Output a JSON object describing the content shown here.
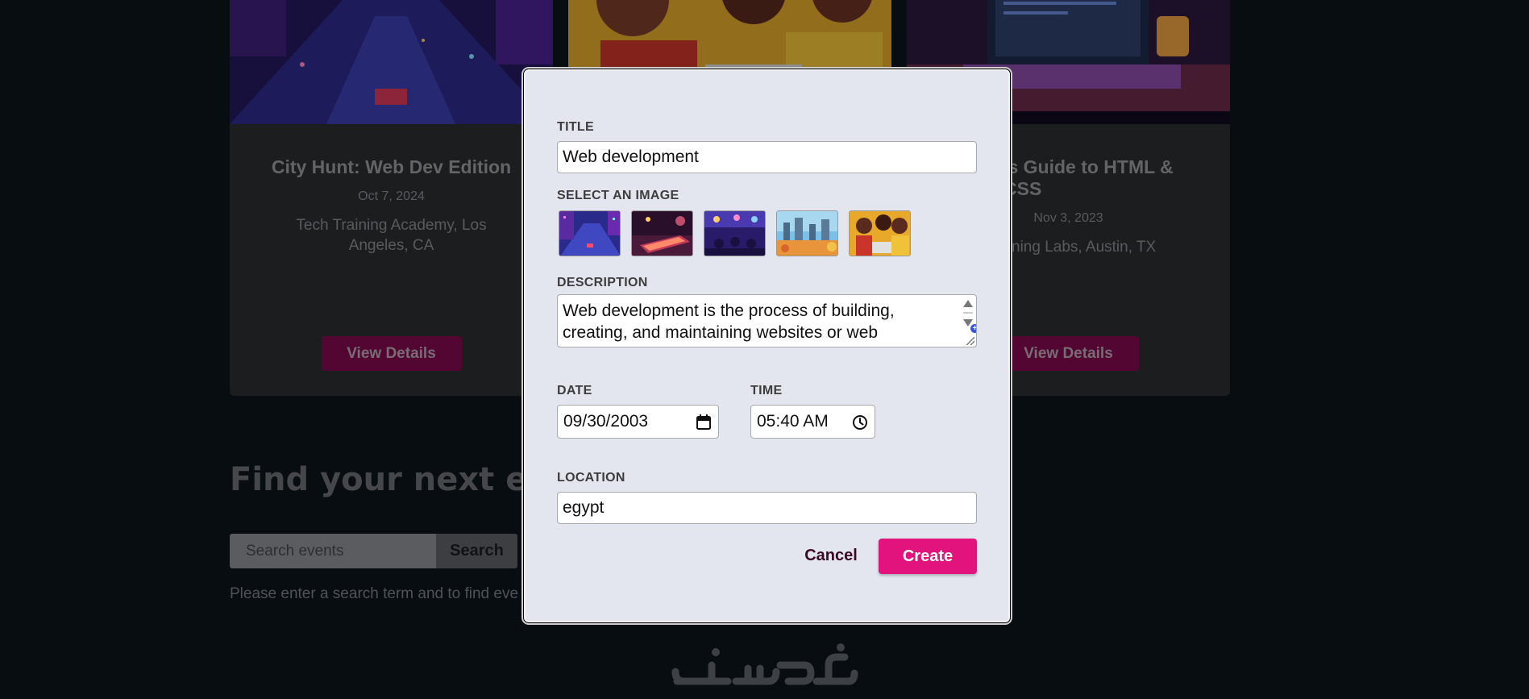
{
  "background": {
    "cards": [
      {
        "title": "City Hunt: Web Dev Edition",
        "date": "Oct 7, 2024",
        "location": "Tech Training Academy, Los Angeles, CA",
        "button": "View Details"
      },
      {
        "title": "",
        "date": "",
        "location": "",
        "button": ""
      },
      {
        "title": "'s Guide to HTML & CSS",
        "date": "Nov 3, 2023",
        "location": "ning Labs, Austin, TX",
        "button": "View Details"
      }
    ],
    "find_title": "Find your next eve",
    "search": {
      "placeholder": "Search events",
      "button": "Search"
    },
    "search_help": "Please enter a search term and to find eve",
    "brand": "logo"
  },
  "modal": {
    "title_label": "TITLE",
    "title_value": "Web development",
    "image_label": "SELECT AN IMAGE",
    "images": [
      "city-night-image",
      "keyboard-stage-image",
      "concert-crowd-image",
      "city-sunset-image",
      "friends-laptop-image"
    ],
    "description_label": "DESCRIPTION",
    "description_value": "Web development is the process of building, creating, and maintaining websites or web",
    "date_label": "DATE",
    "date_value": "09/30/2003",
    "time_label": "TIME",
    "time_value": "05:40 AM",
    "location_label": "LOCATION",
    "location_value": "egypt",
    "cancel_button": "Cancel",
    "create_button": "Create"
  },
  "colors": {
    "page_bg": "#0d141b",
    "modal_bg": "#e3e6ef",
    "accent": "#e2137c"
  }
}
